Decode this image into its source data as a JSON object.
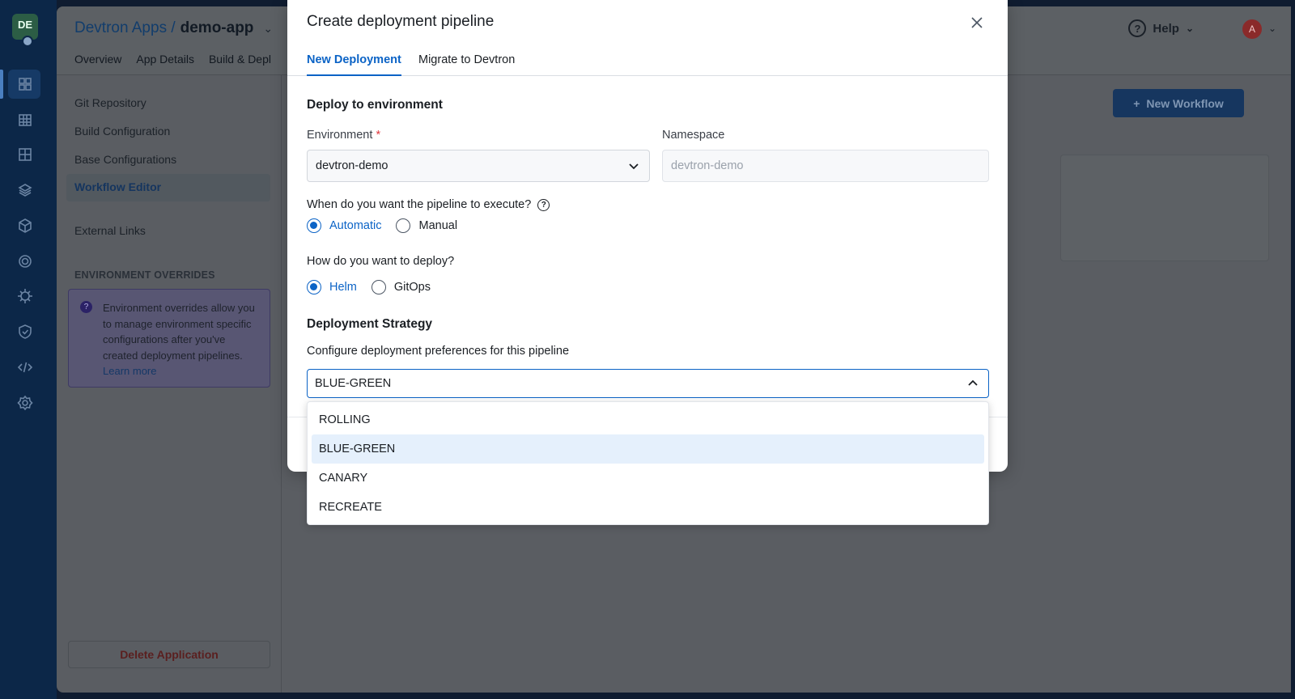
{
  "rail": {
    "logo_text": "DE",
    "icons": [
      "apps-grid-icon",
      "charts-icon",
      "app-grid-icon",
      "stack-icon",
      "cube-icon",
      "target-icon",
      "cluster-wheel-icon",
      "shield-icon",
      "code-icon",
      "settings-gear-icon"
    ]
  },
  "header": {
    "breadcrumb_parent": "Devtron Apps /",
    "app_name": "demo-app",
    "tabs": [
      "Overview",
      "App Details",
      "Build & Depl"
    ],
    "help_label": "Help",
    "avatar_initial": "A"
  },
  "sidebar": {
    "items": [
      "Git Repository",
      "Build Configuration",
      "Base Configurations",
      "Workflow Editor",
      "External Links"
    ],
    "overrides_title": "ENVIRONMENT OVERRIDES",
    "overrides_note": "Environment overrides allow you to manage environment specific configurations after you've created deployment pipelines.",
    "learn_more": "Learn more",
    "delete_label": "Delete Application"
  },
  "toolbar": {
    "new_workflow_label": "New Workflow"
  },
  "modal": {
    "title": "Create deployment pipeline",
    "tabs": [
      "New Deployment",
      "Migrate to Devtron"
    ],
    "deploy_section_title": "Deploy to environment",
    "environment_label": "Environment",
    "environment_value": "devtron-demo",
    "namespace_label": "Namespace",
    "namespace_value": "devtron-demo",
    "execute_question": "When do you want the pipeline to execute?",
    "execute_options": [
      "Automatic",
      "Manual"
    ],
    "execute_selected": "Automatic",
    "deploy_question": "How do you want to deploy?",
    "deploy_options": [
      "Helm",
      "GitOps"
    ],
    "deploy_selected": "Helm",
    "strategy_title": "Deployment Strategy",
    "strategy_hint": "Configure deployment preferences for this pipeline",
    "strategy_value": "BLUE-GREEN",
    "strategy_options": [
      "ROLLING",
      "BLUE-GREEN",
      "CANARY",
      "RECREATE"
    ]
  },
  "colors": {
    "accent": "#0b63c6",
    "selected_option_bg": "#e5f0fc"
  }
}
